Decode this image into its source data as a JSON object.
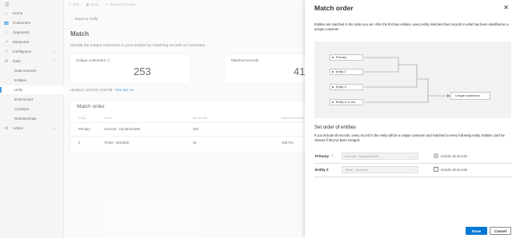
{
  "sidebar": {
    "menu_icon": "hamburger-icon",
    "items": [
      {
        "label": "Home",
        "icon": "home-icon"
      },
      {
        "label": "Customers",
        "icon": "people-icon"
      },
      {
        "label": "Segments",
        "icon": "segments-icon"
      },
      {
        "label": "Measures",
        "icon": "measures-icon"
      },
      {
        "label": "Intelligence",
        "icon": "intelligence-icon"
      },
      {
        "label": "Data",
        "icon": "data-icon"
      },
      {
        "label": "Data sources"
      },
      {
        "label": "Entities"
      },
      {
        "label": "Unify"
      },
      {
        "label": "Enrichment"
      },
      {
        "label": "Activities"
      },
      {
        "label": "Relationships"
      },
      {
        "label": "Admin",
        "icon": "admin-gear-icon"
      }
    ]
  },
  "toolbar": {
    "run": "Run",
    "save": "Save",
    "discard": "Discard changes"
  },
  "main": {
    "back": "Back to Unify",
    "title": "Match",
    "description": "Identify the unique customers in your entities by matching records of customers.",
    "cards": [
      {
        "label": "Unique customers",
        "value": "253"
      },
      {
        "label": "Matched records",
        "value": "41"
      }
    ],
    "updated": "Updated: 12/12/19, 3:00 PM",
    "view_last_run": "View last run",
    "match_order": {
      "title": "Match order",
      "headers": [
        "Entity",
        "Name",
        "All records",
        "Records matche"
      ],
      "rows": [
        {
          "entity": "Primary",
          "name": "Account : Dynamics365",
          "all": "253",
          "matched": ""
        },
        {
          "entity": "2",
          "name": "Ticket : Zendesk",
          "all": "41",
          "matched": "100.0%"
        }
      ]
    }
  },
  "panel": {
    "title": "Match order",
    "description": "Entities are matched in the order you set. After the first two entities, every entity matches their records to what has been identified as a unique customer.",
    "diagram": {
      "boxes": [
        "Primary",
        "Entity 2",
        "Entity 3",
        "Entity 4, 5, etc."
      ],
      "output": "Unique customers"
    },
    "section_title": "Set order of entities",
    "section_desc": "If you include all records, every record in the entity will be a unique customer and matched to every following entity. Entities can't be cleared if they've been merged.",
    "rows": [
      {
        "label": "Primary",
        "value": "Account : Dynamics365",
        "checkbox": "Include all records",
        "checked": true
      },
      {
        "label": "Entity 2",
        "value": "Ticket : Zendesk",
        "checkbox": "Include all records",
        "checked": false
      }
    ],
    "done": "Done",
    "cancel": "Cancel"
  },
  "colors": {
    "accent": "#0078d4",
    "sidebar_bg": "#f3f2f1",
    "panel_bg": "#ffffff"
  }
}
